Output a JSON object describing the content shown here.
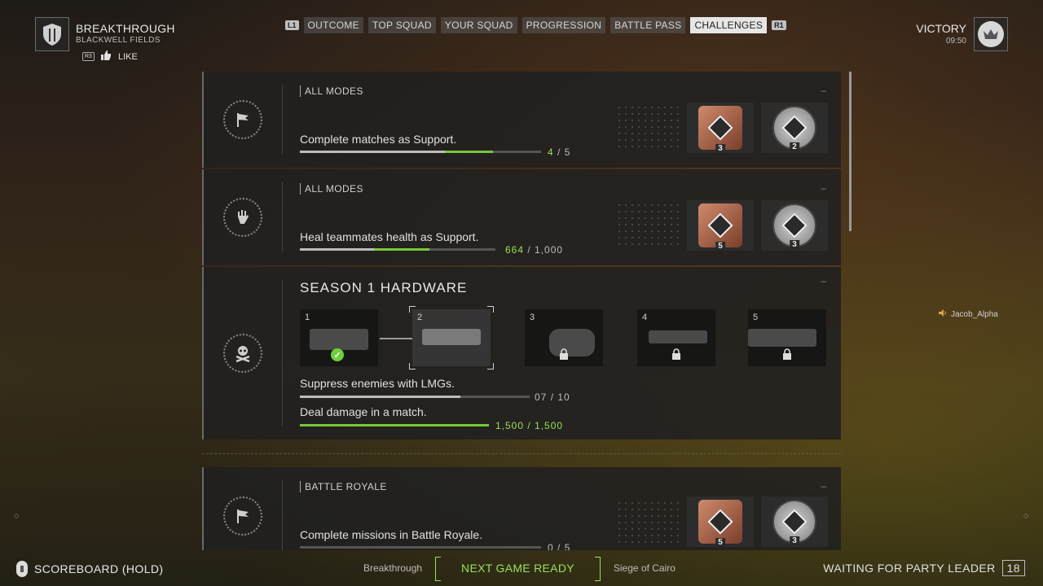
{
  "header": {
    "mode_title": "BREAKTHROUGH",
    "map_name": "BLACKWELL FIELDS",
    "r3_label": "R3",
    "like_label": "LIKE",
    "result": "VICTORY",
    "time": "09:50"
  },
  "tabs": {
    "left_bumper": "L1",
    "right_bumper": "R1",
    "items": [
      {
        "label": "OUTCOME"
      },
      {
        "label": "TOP SQUAD"
      },
      {
        "label": "YOUR SQUAD"
      },
      {
        "label": "PROGRESSION"
      },
      {
        "label": "BATTLE PASS"
      },
      {
        "label": "CHALLENGES",
        "active": true
      }
    ]
  },
  "challenges": [
    {
      "mode": "ALL MODES",
      "description": "Complete matches as Support.",
      "progress_current": "4",
      "progress_total": "5",
      "progress_fraction": 0.8,
      "prev_fraction": 0.6,
      "rewards": [
        {
          "tier": "bronze",
          "count": "3"
        },
        {
          "tier": "silver",
          "count": "2"
        }
      ]
    },
    {
      "mode": "ALL MODES",
      "description": "Heal teammates health as Support.",
      "progress_current": "664",
      "progress_total": "1,000",
      "progress_fraction": 0.664,
      "prev_fraction": 0.38,
      "rewards": [
        {
          "tier": "bronze",
          "count": "5"
        },
        {
          "tier": "silver",
          "count": "3"
        }
      ]
    },
    {
      "mode": "BATTLE ROYALE",
      "description": "Complete missions in Battle Royale.",
      "progress_current": "0",
      "progress_total": "5",
      "progress_fraction": 0,
      "prev_fraction": 0,
      "rewards": [
        {
          "tier": "bronze",
          "count": "5"
        },
        {
          "tier": "silver",
          "count": "3"
        }
      ]
    }
  ],
  "season": {
    "title": "SEASON 1 HARDWARE",
    "slots": [
      {
        "num": "1",
        "state": "complete"
      },
      {
        "num": "2",
        "state": "selected"
      },
      {
        "num": "3",
        "state": "locked"
      },
      {
        "num": "4",
        "state": "locked"
      },
      {
        "num": "5",
        "state": "locked"
      }
    ],
    "task1_desc": "Suppress enemies with LMGs.",
    "task1_current": "07",
    "task1_total": "10",
    "task1_fraction": 0.7,
    "task2_desc": "Deal damage in a match.",
    "task2_current": "1,500",
    "task2_total": "1,500",
    "task2_fraction": 1.0
  },
  "player_tag": "Jacob_Alpha",
  "footer": {
    "scoreboard": "SCOREBOARD (HOLD)",
    "prev_mode": "Breakthrough",
    "ready": "NEXT GAME READY",
    "next_map": "Siege of Cairo",
    "waiting": "WAITING FOR PARTY LEADER",
    "countdown": "18"
  },
  "colors": {
    "accent_green": "#9be05a",
    "bronze": "#b8654a",
    "silver": "#bdbdbd"
  }
}
